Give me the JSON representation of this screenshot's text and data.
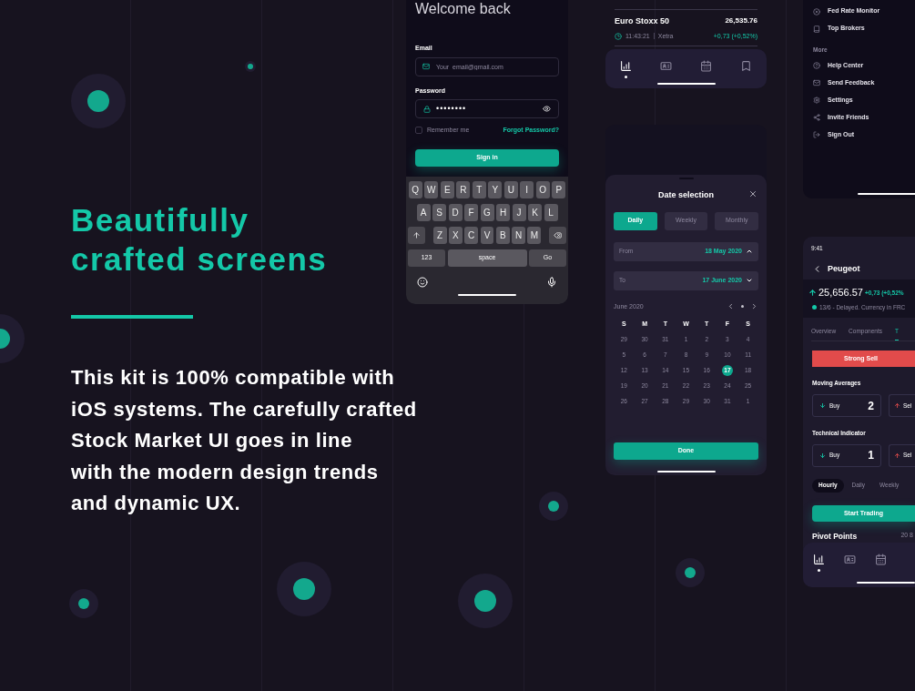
{
  "hero": {
    "heading_lines": [
      "Beautifully",
      "crafted screens"
    ],
    "body_lines": [
      "This kit is 100% compatible with",
      "iOS systems. The carefully crafted",
      "Stock Market UI goes in line",
      "with the modern design trends",
      "and dynamic UX."
    ]
  },
  "login": {
    "title": "Welcome back",
    "email_label": "Email",
    "email_placeholder": "Your_email@gmail.com",
    "password_label": "Password",
    "password_value": "••••••••",
    "remember": {
      "label": "Remember me",
      "checked": false
    },
    "forgot": "Forgot Password?",
    "sign_in": "Sign in",
    "keyboard": {
      "rows": [
        [
          "Q",
          "W",
          "E",
          "R",
          "T",
          "Y",
          "U",
          "I",
          "O",
          "P"
        ],
        [
          "A",
          "S",
          "D",
          "F",
          "G",
          "H",
          "J",
          "K",
          "L"
        ],
        [
          "Z",
          "X",
          "C",
          "V",
          "B",
          "N",
          "M"
        ]
      ],
      "numbers": "123",
      "space": "space",
      "go": "Go"
    }
  },
  "market": {
    "rows": [
      {
        "name": "Euro Stoxx 50",
        "value": "26,535.76",
        "time": "11:43:21",
        "exchange": "Xetra",
        "change": "+0,73 (+0,52%)"
      }
    ],
    "nav": [
      {
        "kind": "chart",
        "selected": true
      },
      {
        "kind": "card",
        "selected": false
      },
      {
        "kind": "calendar",
        "selected": false
      },
      {
        "kind": "bookmark",
        "selected": false
      }
    ]
  },
  "date_sheet": {
    "title": "Date selection",
    "periods": [
      {
        "label": "Daily",
        "selected": true
      },
      {
        "label": "Weekly",
        "selected": false
      },
      {
        "label": "Monthly",
        "selected": false
      }
    ],
    "from": {
      "label": "From",
      "value": "18 May 2020",
      "expanded": true
    },
    "to": {
      "label": "To",
      "value": "17 June 2020",
      "expanded": false
    },
    "month": "June 2020",
    "weekdays": [
      "S",
      "M",
      "T",
      "W",
      "T",
      "F",
      "S"
    ],
    "days": [
      {
        "label": "29",
        "selected": false
      },
      {
        "label": "30",
        "selected": false
      },
      {
        "label": "31",
        "selected": false
      },
      {
        "label": "1",
        "selected": false
      },
      {
        "label": "2",
        "selected": false
      },
      {
        "label": "3",
        "selected": false
      },
      {
        "label": "4",
        "selected": false
      },
      {
        "label": "5",
        "selected": false
      },
      {
        "label": "6",
        "selected": false
      },
      {
        "label": "7",
        "selected": false
      },
      {
        "label": "8",
        "selected": false
      },
      {
        "label": "9",
        "selected": false
      },
      {
        "label": "10",
        "selected": false
      },
      {
        "label": "11",
        "selected": false
      },
      {
        "label": "12",
        "selected": false
      },
      {
        "label": "13",
        "selected": false
      },
      {
        "label": "14",
        "selected": false
      },
      {
        "label": "15",
        "selected": false
      },
      {
        "label": "16",
        "selected": false
      },
      {
        "label": "17",
        "selected": true
      },
      {
        "label": "18",
        "selected": false
      },
      {
        "label": "19",
        "selected": false
      },
      {
        "label": "20",
        "selected": false
      },
      {
        "label": "21",
        "selected": false
      },
      {
        "label": "22",
        "selected": false
      },
      {
        "label": "23",
        "selected": false
      },
      {
        "label": "24",
        "selected": false
      },
      {
        "label": "25",
        "selected": false
      },
      {
        "label": "26",
        "selected": false
      },
      {
        "label": "27",
        "selected": false
      },
      {
        "label": "28",
        "selected": false
      },
      {
        "label": "29",
        "selected": false
      },
      {
        "label": "30",
        "selected": false
      },
      {
        "label": "31",
        "selected": false
      },
      {
        "label": "1",
        "selected": false
      }
    ],
    "done": "Done"
  },
  "menu": {
    "items": [
      {
        "kind": "circle-x",
        "label": "Fed Rate Monitor"
      },
      {
        "kind": "book",
        "label": "Top Brokers"
      }
    ],
    "section": "More",
    "more_items": [
      {
        "kind": "help",
        "label": "Help Center"
      },
      {
        "kind": "mail",
        "label": "Send Feedback"
      },
      {
        "kind": "settings",
        "label": "Settings"
      },
      {
        "kind": "share",
        "label": "Invite Friends"
      },
      {
        "kind": "logout",
        "label": "Sign Out"
      }
    ]
  },
  "stock": {
    "time": "9:41",
    "title": "Peugeot",
    "price": "25,656.57",
    "change": "+0,73 (+0,52%",
    "note": "13/6 - Delayed. Currency in FRC",
    "tabs": [
      {
        "label": "Overview",
        "selected": false
      },
      {
        "label": "Components",
        "selected": false
      },
      {
        "label": "T",
        "selected": true
      }
    ],
    "signal": "Strong Sell",
    "sections": [
      {
        "title": "Moving Averages",
        "buy_label": "Buy",
        "buy_count": "2",
        "sell_label": "Sel"
      },
      {
        "title": "Technical Indicator",
        "buy_label": "Buy",
        "buy_count": "1",
        "sell_label": "Sel"
      }
    ],
    "periods": [
      {
        "label": "Hourly",
        "selected": true
      },
      {
        "label": "Daily",
        "selected": false
      },
      {
        "label": "Weekly",
        "selected": false
      }
    ],
    "start": "Start Trading",
    "pivot_title": "Pivot Points",
    "pivot_value": "20 8",
    "nav": [
      {
        "kind": "chart",
        "selected": true
      },
      {
        "kind": "card",
        "selected": false
      },
      {
        "kind": "calendar",
        "selected": false
      }
    ]
  }
}
